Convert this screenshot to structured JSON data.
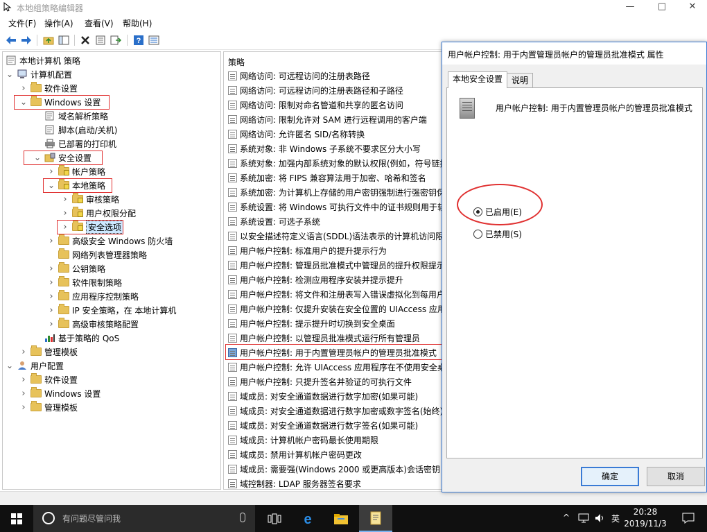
{
  "window": {
    "title": "本地组策略编辑器",
    "controls": {
      "minimize": "—",
      "maximize": "□",
      "close": "✕"
    }
  },
  "menu": [
    "文件(F)",
    "操作(A)",
    "查看(V)",
    "帮助(H)"
  ],
  "toolbar_icons": [
    "back-icon",
    "forward-icon",
    "up-folder-icon",
    "show-tree-icon",
    "delete-icon",
    "properties-icon",
    "export-icon",
    "help-icon",
    "filter-icon"
  ],
  "tree": {
    "root": "本地计算机 策略",
    "items": [
      {
        "label": "计算机配置",
        "level": 1,
        "expanded": true
      },
      {
        "label": "软件设置",
        "level": 2,
        "expanded": false
      },
      {
        "label": "Windows 设置",
        "level": 2,
        "expanded": true
      },
      {
        "label": "域名解析策略",
        "level": 3
      },
      {
        "label": "脚本(启动/关机)",
        "level": 3
      },
      {
        "label": "已部署的打印机",
        "level": 3
      },
      {
        "label": "安全设置",
        "level": 3,
        "expanded": true
      },
      {
        "label": "帐户策略",
        "level": 4,
        "expanded": false
      },
      {
        "label": "本地策略",
        "level": 4,
        "expanded": true
      },
      {
        "label": "审核策略",
        "level": 5
      },
      {
        "label": "用户权限分配",
        "level": 5
      },
      {
        "label": "安全选项",
        "level": 5,
        "selected": true
      },
      {
        "label": "高级安全 Windows 防火墙",
        "level": 4
      },
      {
        "label": "网络列表管理器策略",
        "level": 4
      },
      {
        "label": "公钥策略",
        "level": 4
      },
      {
        "label": "软件限制策略",
        "level": 4
      },
      {
        "label": "应用程序控制策略",
        "level": 4
      },
      {
        "label": "IP 安全策略，在 本地计算机",
        "level": 4
      },
      {
        "label": "高级审核策略配置",
        "level": 4
      },
      {
        "label": "基于策略的 QoS",
        "level": 3
      },
      {
        "label": "管理模板",
        "level": 2
      },
      {
        "label": "用户配置",
        "level": 1,
        "expanded": true
      },
      {
        "label": "软件设置",
        "level": 2
      },
      {
        "label": "Windows 设置",
        "level": 2
      },
      {
        "label": "管理模板",
        "level": 2
      }
    ]
  },
  "list": {
    "header": "策略",
    "rows": [
      "网络访问: 可远程访问的注册表路径",
      "网络访问: 可远程访问的注册表路径和子路径",
      "网络访问: 限制对命名管道和共享的匿名访问",
      "网络访问: 限制允许对 SAM 进行远程调用的客户端",
      "网络访问: 允许匿名 SID/名称转换",
      "系统对象: 非 Windows 子系统不要求区分大小写",
      "系统对象: 加强内部系统对象的默认权限(例如，符号链接",
      "系统加密: 将 FIPS 兼容算法用于加密、哈希和签名",
      "系统加密: 为计算机上存储的用户密钥强制进行强密钥保",
      "系统设置: 将 Windows 可执行文件中的证书规则用于软",
      "系统设置: 可选子系统",
      "以安全描述符定义语言(SDDL)语法表示的计算机访问限",
      "用户帐户控制: 标准用户的提升提示行为",
      "用户帐户控制: 管理员批准模式中管理员的提升权限提示",
      "用户帐户控制: 检测应用程序安装并提示提升",
      "用户帐户控制: 将文件和注册表写入错误虚拟化到每用户",
      "用户帐户控制: 仅提升安装在安全位置的 UIAccess 应用",
      "用户帐户控制: 提示提升时切换到安全桌面",
      "用户帐户控制: 以管理员批准模式运行所有管理员",
      "用户帐户控制: 用于内置管理员帐户的管理员批准模式",
      "用户帐户控制: 允许 UIAccess 应用程序在不使用安全桌",
      "用户帐户控制: 只提升签名并验证的可执行文件",
      "域成员: 对安全通道数据进行数字加密(如果可能)",
      "域成员: 对安全通道数据进行数字加密或数字签名(始终)",
      "域成员: 对安全通道数据进行数字签名(如果可能)",
      "域成员: 计算机帐户密码最长使用期限",
      "域成员: 禁用计算机帐户密码更改",
      "域成员: 需要强(Windows 2000 或更高版本)会话密钥",
      "域控制器: LDAP 服务器签名要求"
    ],
    "selected_index": 19
  },
  "dialog": {
    "title": "用户帐户控制: 用于内置管理员帐户的管理员批准模式 属性",
    "tabs": [
      "本地安全设置",
      "说明"
    ],
    "policy_name": "用户帐户控制: 用于内置管理员帐户的管理员批准模式",
    "options": [
      {
        "label": "已启用(E)",
        "checked": true
      },
      {
        "label": "已禁用(S)",
        "checked": false
      }
    ],
    "ok": "确定",
    "cancel": "取消"
  },
  "taskbar": {
    "search_placeholder": "有问题尽管问我",
    "tray": {
      "chevron": "^",
      "ime": "英",
      "time": "20:28",
      "date": "2019/11/3"
    }
  },
  "colors": {
    "accent": "#3a7bd5",
    "highlight": "#e03030",
    "taskbar": "#101010"
  }
}
